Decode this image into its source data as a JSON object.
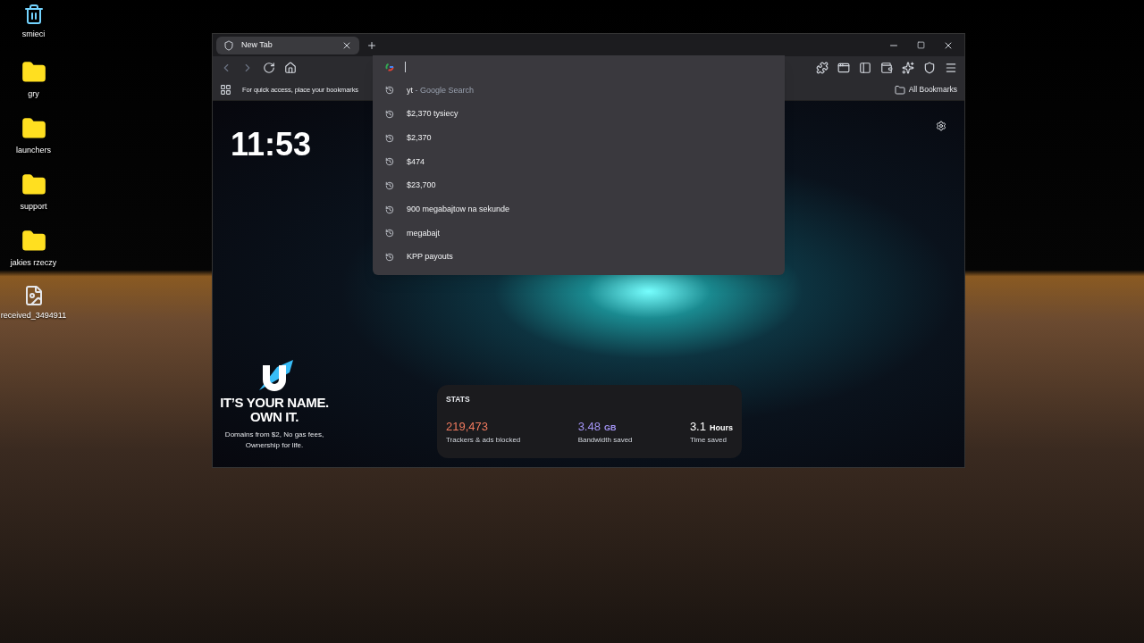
{
  "desktop_icons": [
    {
      "label": "smieci",
      "kind": "recycle"
    },
    {
      "label": "gry",
      "kind": "folder"
    },
    {
      "label": "launchers",
      "kind": "folder"
    },
    {
      "label": "support",
      "kind": "folder"
    },
    {
      "label": "jakies rzeczy",
      "kind": "folder"
    },
    {
      "label": "received_3494911",
      "kind": "file"
    }
  ],
  "browser": {
    "tabs": [
      {
        "title": "New Tab",
        "selected": true
      }
    ],
    "bookmarks_bar": {
      "hint": "For quick access, place your bookmarks",
      "all_bookmarks": "All Bookmarks"
    },
    "suggestions": [
      {
        "text": "yt",
        "note": "- Google Search"
      },
      {
        "text": "$2,370 tysiecy"
      },
      {
        "text": "$2,370"
      },
      {
        "text": "$474"
      },
      {
        "text": "$23,700"
      },
      {
        "text": "900 megabajtow na sekunde"
      },
      {
        "text": "megabajt"
      },
      {
        "text": "KPP payouts"
      }
    ],
    "new_tab": {
      "clock": "11:53",
      "ad": {
        "headline": [
          "IT’S YOUR NAME.",
          "OWN IT."
        ],
        "tagline": [
          "Domains from $2, No gas fees,",
          "Ownership for life."
        ]
      },
      "stats": {
        "title": "STATS",
        "items": [
          {
            "value": "219,473",
            "label": "Trackers & ads blocked",
            "color": "#f07a5e"
          },
          {
            "value": "3.48",
            "unit": "GB",
            "label": "Bandwidth saved",
            "color": "#a394f5"
          },
          {
            "value": "3.1",
            "unit": "Hours",
            "label": "Time saved",
            "color": "#ffffff"
          }
        ]
      }
    }
  }
}
